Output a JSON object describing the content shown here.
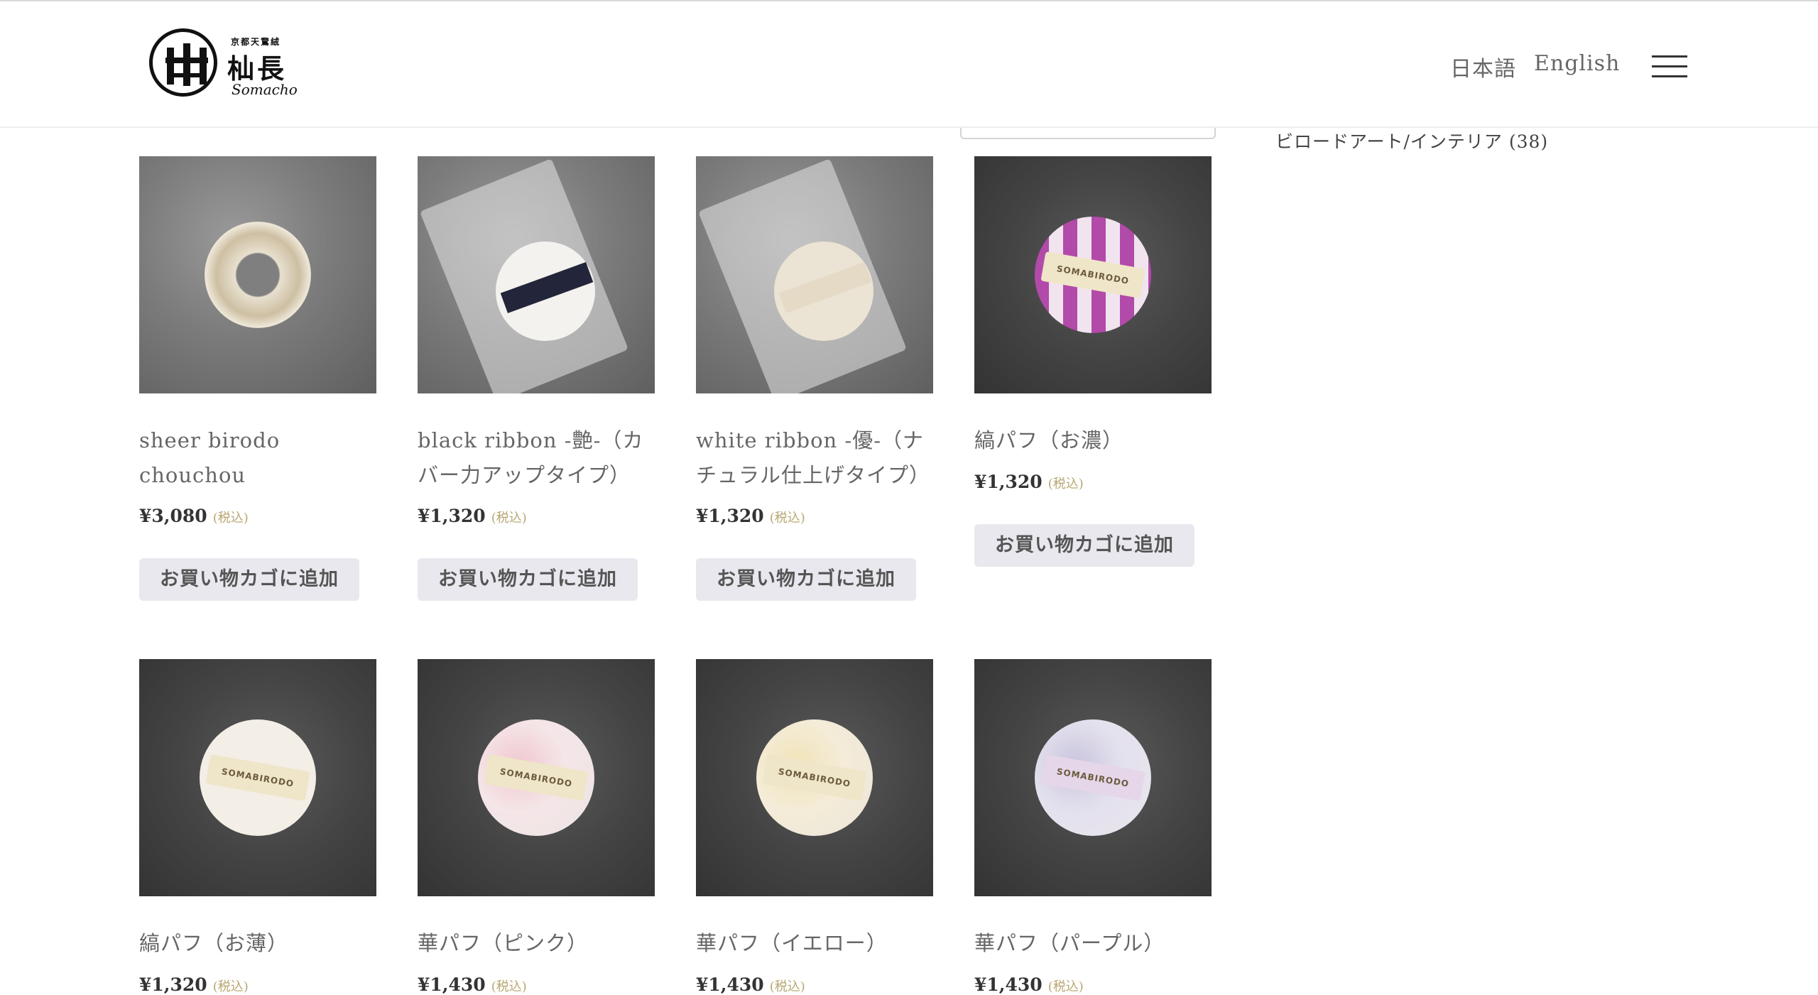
{
  "header": {
    "logo": {
      "small": "京都天鵞絨",
      "main": "杣長",
      "sub": "Somacho"
    },
    "languages": [
      "日本語",
      "English"
    ]
  },
  "sidebar": {
    "category_link": "ビロードアート/インテリア (38)"
  },
  "products": [
    {
      "name": "sheer birodo chouchou",
      "price": "¥3,080",
      "tax": "(税込)",
      "button": "お買い物カゴに追加"
    },
    {
      "name": "black ribbon -艶-（カバー力アップタイプ）",
      "price": "¥1,320",
      "tax": "(税込)",
      "button": "お買い物カゴに追加"
    },
    {
      "name": "white ribbon -優-（ナチュラル仕上げタイプ）",
      "price": "¥1,320",
      "tax": "(税込)",
      "button": "お買い物カゴに追加"
    },
    {
      "name": "縞パフ（お濃）",
      "price": "¥1,320",
      "tax": "(税込)",
      "button": "お買い物カゴに追加"
    },
    {
      "name": "縞パフ（お薄）",
      "price": "¥1,320",
      "tax": "(税込)"
    },
    {
      "name": "華パフ（ピンク）",
      "price": "¥1,430",
      "tax": "(税込)"
    },
    {
      "name": "華パフ（イエロー）",
      "price": "¥1,430",
      "tax": "(税込)"
    },
    {
      "name": "華パフ（パープル）",
      "price": "¥1,430",
      "tax": "(税込)"
    }
  ],
  "ribbon_text": "SOMABIRODO",
  "colors": {
    "accent_tax": "#b8a772",
    "button_bg": "#e9e8ee"
  }
}
